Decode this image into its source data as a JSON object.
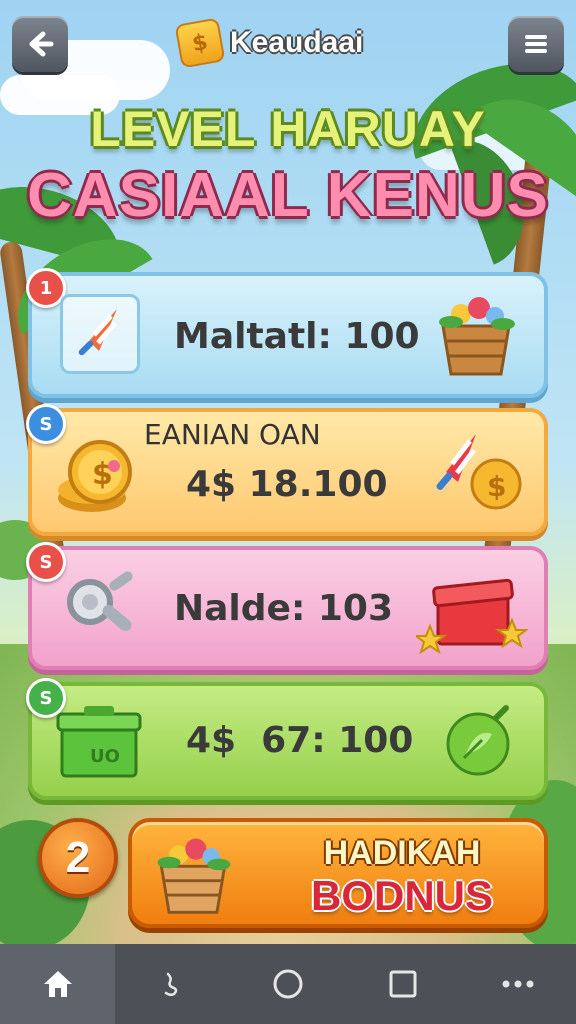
{
  "header": {
    "back_icon": "arrow-left-icon",
    "brand_coin_glyph": "$",
    "brand_name": "Keaudaai",
    "menu_icon": "hamburger-icon"
  },
  "title": {
    "line1": "LEVEL HARUAY",
    "line2": "CASIAAL KENUS"
  },
  "cards": [
    {
      "badge": "1",
      "text": "Maltatl: 100",
      "left_icon": "rocket-popsicle-icon",
      "right_icon": "flower-basket-icon",
      "color": "#bfe6f7"
    },
    {
      "badge": "S",
      "label": "EANIAN OAN",
      "text": "4$ 18.100",
      "left_icon": "coin-stack-icon",
      "right_icon": "rocket-and-coin-icon",
      "color": "#ffd98a"
    },
    {
      "badge": "S",
      "text": "Nalde: 103",
      "left_icon": "magnifier-icon",
      "right_icon": "red-chest-icon",
      "color": "#f6b2d6"
    },
    {
      "badge": "S",
      "text": "4$  67: 100",
      "left_icon": "green-box-icon",
      "box_label": "UO",
      "right_icon": "green-bomb-icon",
      "color": "#a8dc62"
    }
  ],
  "bonus": {
    "level": "2",
    "line1": "HADIKAH",
    "line2": "BODNUS",
    "icon": "flower-basket-icon"
  },
  "navbar": {
    "items": [
      {
        "icon": "home-icon",
        "glyph": "⌂",
        "active": true
      },
      {
        "icon": "back-gesture-icon",
        "glyph": "ʖ"
      },
      {
        "icon": "circle-icon",
        "glyph": "○"
      },
      {
        "icon": "square-icon",
        "glyph": "□"
      },
      {
        "icon": "more-icon",
        "glyph": "•••"
      }
    ]
  }
}
